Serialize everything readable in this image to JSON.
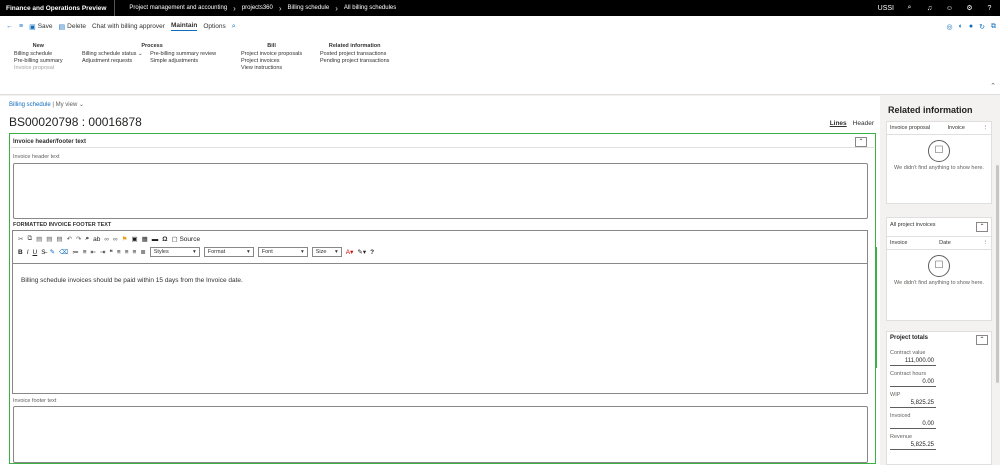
{
  "topbar": {
    "app": "Finance and Operations Preview",
    "crumbs": [
      "Project management and accounting",
      "projects360",
      "Billing schedule",
      "All billing schedules"
    ],
    "company": "USSI",
    "icons": [
      "search-icon",
      "bell-icon",
      "smiley-icon",
      "gear-icon",
      "help-icon"
    ]
  },
  "actionbar": {
    "save": "Save",
    "delete": "Delete",
    "chat": "Chat with billing approver",
    "tabs": [
      "Maintain",
      "Options"
    ]
  },
  "ribbon": {
    "new": {
      "header": "New",
      "items": [
        "Billing schedule",
        "Pre-billing summary",
        "Invoice proposal"
      ]
    },
    "process": {
      "header": "Process",
      "col1": [
        "Billing schedule status",
        "Adjustment requests"
      ],
      "col2": [
        "Pre-billing summary review",
        "Simple adjustments"
      ]
    },
    "bill": {
      "header": "Bill",
      "items": [
        "Project invoice proposals",
        "Project invoices",
        "View instructions"
      ]
    },
    "related": {
      "header": "Related information",
      "items": [
        "Posted project transactions",
        "Pending project transactions"
      ]
    }
  },
  "main": {
    "breadcrumb": "Billing schedule",
    "view": "My view",
    "title": "BS00020798 : 00016878",
    "viewtabs": [
      "Lines",
      "Header"
    ]
  },
  "panel": {
    "header": "Invoice header/footer text",
    "header_text_label": "Invoice header text",
    "formatted_label": "FORMATTED INVOICE FOOTER TEXT",
    "source": "Source",
    "styles": "Styles",
    "format": "Format",
    "font": "Font",
    "size": "Size",
    "body": "Billing schedule invoices should be paid within 15 days from the Invoice date.",
    "footer_text_label": "Invoice footer text"
  },
  "side": {
    "title": "Related information",
    "card1": {
      "col1": "Invoice proposal",
      "col2": "Invoice",
      "empty": "We didn't find anything to show here."
    },
    "card2": {
      "title": "All project invoices",
      "col1": "Invoice",
      "col2": "Date",
      "empty": "We didn't find anything to show here."
    },
    "totals": {
      "title": "Project totals",
      "fields": [
        {
          "label": "Contract value",
          "value": "111,000.00"
        },
        {
          "label": "Contract hours",
          "value": "0.00"
        },
        {
          "label": "WIP",
          "value": "5,825.25"
        },
        {
          "label": "Invoiced",
          "value": "0.00"
        },
        {
          "label": "Revenue",
          "value": "5,825.25"
        }
      ]
    }
  }
}
